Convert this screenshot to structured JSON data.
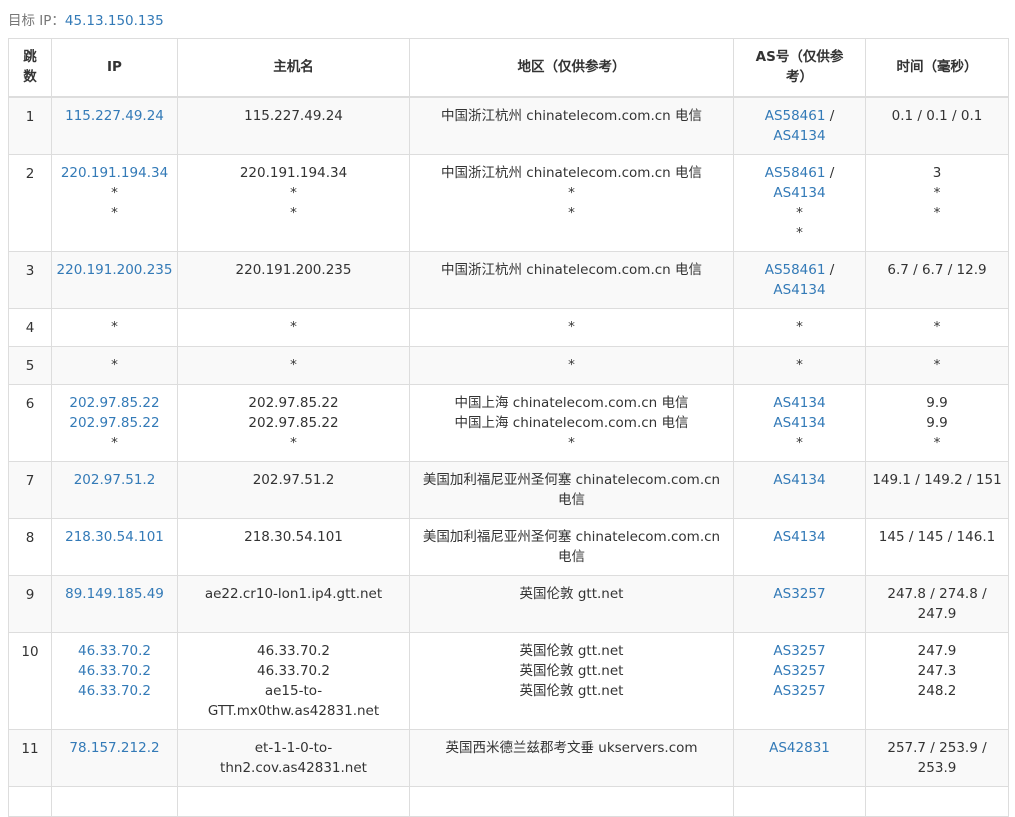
{
  "target": {
    "label": "目标 IP：",
    "ip": "45.13.150.135"
  },
  "headers": {
    "hop": "跳数",
    "ip": "IP",
    "host": "主机名",
    "region": "地区（仅供参考）",
    "as": "AS号（仅供参考）",
    "time": "时间（毫秒）"
  },
  "rows": [
    {
      "hop": "1",
      "ips": [
        "115.227.49.24"
      ],
      "hosts": [
        "115.227.49.24"
      ],
      "regions": [
        "中国浙江杭州 chinatelecom.com.cn 电信"
      ],
      "as": [
        [
          "AS58461",
          "AS4134"
        ]
      ],
      "times": [
        "0.1 / 0.1 / 0.1"
      ]
    },
    {
      "hop": "2",
      "ips": [
        "220.191.194.34",
        "*",
        "*"
      ],
      "hosts": [
        "220.191.194.34",
        "*",
        "*"
      ],
      "regions": [
        "中国浙江杭州 chinatelecom.com.cn 电信",
        "*",
        "*"
      ],
      "as": [
        [
          "AS58461",
          "AS4134"
        ],
        [
          "*"
        ],
        [
          "*"
        ]
      ],
      "times": [
        "3",
        "*",
        "*"
      ]
    },
    {
      "hop": "3",
      "ips": [
        "220.191.200.235"
      ],
      "hosts": [
        "220.191.200.235"
      ],
      "regions": [
        "中国浙江杭州 chinatelecom.com.cn 电信"
      ],
      "as": [
        [
          "AS58461",
          "AS4134"
        ]
      ],
      "times": [
        "6.7 / 6.7 / 12.9"
      ]
    },
    {
      "hop": "4",
      "ips": [
        "*"
      ],
      "hosts": [
        "*"
      ],
      "regions": [
        "*"
      ],
      "as": [
        [
          "*"
        ]
      ],
      "times": [
        "*"
      ]
    },
    {
      "hop": "5",
      "ips": [
        "*"
      ],
      "hosts": [
        "*"
      ],
      "regions": [
        "*"
      ],
      "as": [
        [
          "*"
        ]
      ],
      "times": [
        "*"
      ]
    },
    {
      "hop": "6",
      "ips": [
        "202.97.85.22",
        "202.97.85.22",
        "*"
      ],
      "hosts": [
        "202.97.85.22",
        "202.97.85.22",
        "*"
      ],
      "regions": [
        "中国上海 chinatelecom.com.cn 电信",
        "中国上海 chinatelecom.com.cn 电信",
        "*"
      ],
      "as": [
        [
          "AS4134"
        ],
        [
          "AS4134"
        ],
        [
          "*"
        ]
      ],
      "times": [
        "9.9",
        "9.9",
        "*"
      ]
    },
    {
      "hop": "7",
      "ips": [
        "202.97.51.2"
      ],
      "hosts": [
        "202.97.51.2"
      ],
      "regions": [
        "美国加利福尼亚州圣何塞 chinatelecom.com.cn 电信"
      ],
      "as": [
        [
          "AS4134"
        ]
      ],
      "times": [
        "149.1 / 149.2 / 151"
      ]
    },
    {
      "hop": "8",
      "ips": [
        "218.30.54.101"
      ],
      "hosts": [
        "218.30.54.101"
      ],
      "regions": [
        "美国加利福尼亚州圣何塞 chinatelecom.com.cn 电信"
      ],
      "as": [
        [
          "AS4134"
        ]
      ],
      "times": [
        "145 / 145 / 146.1"
      ]
    },
    {
      "hop": "9",
      "ips": [
        "89.149.185.49"
      ],
      "hosts": [
        "ae22.cr10-lon1.ip4.gtt.net"
      ],
      "regions": [
        "英国伦敦 gtt.net"
      ],
      "as": [
        [
          "AS3257"
        ]
      ],
      "times": [
        "247.8 / 274.8 / 247.9"
      ]
    },
    {
      "hop": "10",
      "ips": [
        "46.33.70.2",
        "46.33.70.2",
        "46.33.70.2"
      ],
      "hosts": [
        "46.33.70.2",
        "46.33.70.2",
        "ae15-to-GTT.mx0thw.as42831.net"
      ],
      "regions": [
        "英国伦敦 gtt.net",
        "英国伦敦 gtt.net",
        "英国伦敦 gtt.net"
      ],
      "as": [
        [
          "AS3257"
        ],
        [
          "AS3257"
        ],
        [
          "AS3257"
        ]
      ],
      "times": [
        "247.9",
        "247.3",
        "248.2"
      ]
    },
    {
      "hop": "11",
      "ips": [
        "78.157.212.2"
      ],
      "hosts": [
        "et-1-1-0-to-thn2.cov.as42831.net"
      ],
      "regions": [
        "英国西米德兰兹郡考文垂 ukservers.com"
      ],
      "as": [
        [
          "AS42831"
        ]
      ],
      "times": [
        "257.7 / 253.9 / 253.9"
      ]
    },
    {
      "hop": "",
      "ips": [
        ""
      ],
      "hosts": [
        ""
      ],
      "regions": [
        ""
      ],
      "as": [
        [
          ""
        ]
      ],
      "times": [
        ""
      ]
    }
  ]
}
